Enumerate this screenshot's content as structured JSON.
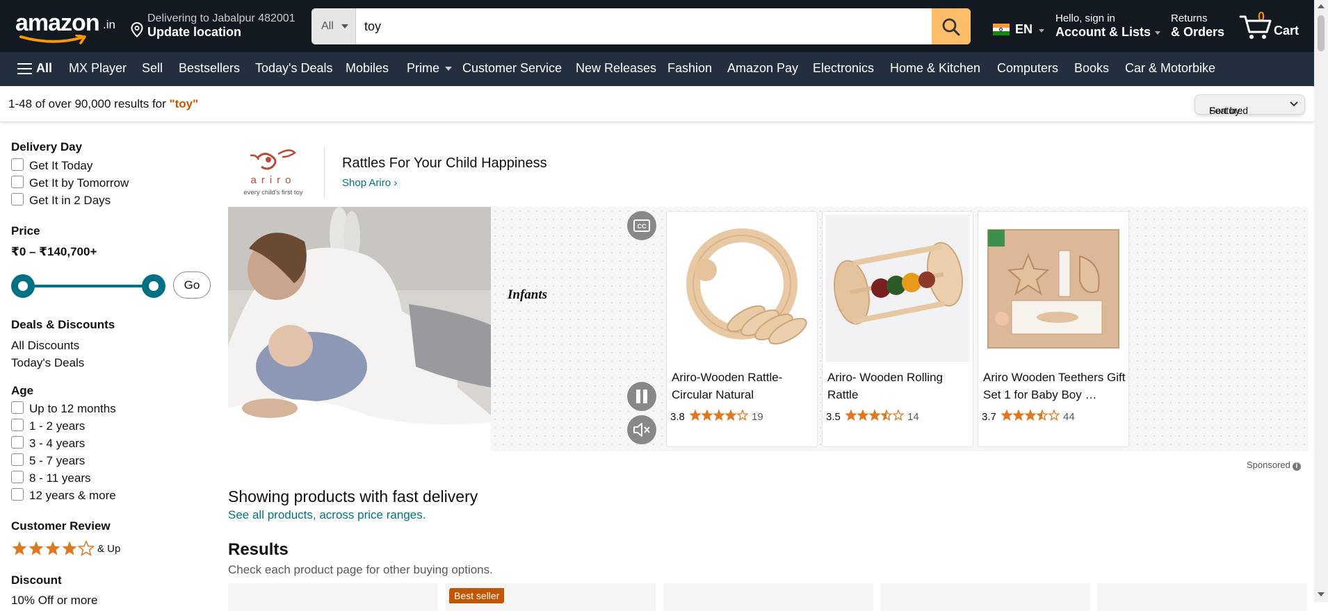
{
  "header": {
    "logo_text": "amazon",
    "logo_tld": ".in",
    "delivery_line1": "Delivering to Jabalpur 482001",
    "delivery_line2": "Update location",
    "search_dept": "All",
    "search_value": "toy",
    "language": "EN",
    "account_line1": "Hello, sign in",
    "account_line2": "Account & Lists",
    "returns_line1": "Returns",
    "returns_line2": "& Orders",
    "cart_count": "0",
    "cart_label": "Cart"
  },
  "subnav": {
    "all": "All",
    "items": [
      "MX Player",
      "Sell",
      "Bestsellers",
      "Today's Deals",
      "Mobiles",
      "Prime",
      "Customer Service",
      "New Releases",
      "Fashion",
      "Amazon Pay",
      "Electronics",
      "Home & Kitchen",
      "Computers",
      "Books",
      "Car & Motorbike"
    ]
  },
  "results_bar": {
    "count_text": "1-48 of over 90,000 results for ",
    "query": "\"toy\"",
    "sort_label": "Sort by:",
    "sort_value": "Featured"
  },
  "sidebar": {
    "delivery_heading": "Delivery Day",
    "delivery_options": [
      "Get It Today",
      "Get It by Tomorrow",
      "Get It in 2 Days"
    ],
    "price_heading": "Price",
    "price_range": "₹0 – ₹140,700+",
    "go_label": "Go",
    "deals_heading": "Deals & Discounts",
    "deals_links": [
      "All Discounts",
      "Today's Deals"
    ],
    "age_heading": "Age",
    "age_options": [
      "Up to 12 months",
      "1 - 2 years",
      "3 - 4 years",
      "5 - 7 years",
      "8 - 11 years",
      "12 years & more"
    ],
    "review_heading": "Customer Review",
    "review_stars": 4,
    "review_up": "& Up",
    "discount_heading": "Discount",
    "discount_first": "10% Off or more"
  },
  "sponsored_banner": {
    "brand_logo_text": "ariro",
    "brand_tagline": "every child's first toy",
    "title": "Rattles For Your Child Happiness",
    "shop_link": "Shop Ariro ›",
    "video_caption": "Infants",
    "products": [
      {
        "name": "Ariro-Wooden Rattle-Circular Natural",
        "rating": "3.8",
        "stars": 3.8,
        "count": "19"
      },
      {
        "name": "Ariro- Wooden Rolling Rattle",
        "rating": "3.5",
        "stars": 3.5,
        "count": "14"
      },
      {
        "name": "Ariro Wooden Teethers Gift Set 1 for Baby Boy …",
        "rating": "3.7",
        "stars": 3.7,
        "count": "44"
      }
    ],
    "sponsored_label": "Sponsored"
  },
  "main": {
    "fast_title": "Showing products with fast delivery",
    "fast_link": "See all products, across price ranges.",
    "results_heading": "Results",
    "results_sub": "Check each product page for other buying options.",
    "best_seller_badge": "Best seller"
  },
  "colors": {
    "nav_bg": "#131921",
    "subnav_bg": "#232f3e",
    "search_button": "#febd69",
    "link": "#007185",
    "star": "#de7921",
    "query": "#c45500"
  }
}
